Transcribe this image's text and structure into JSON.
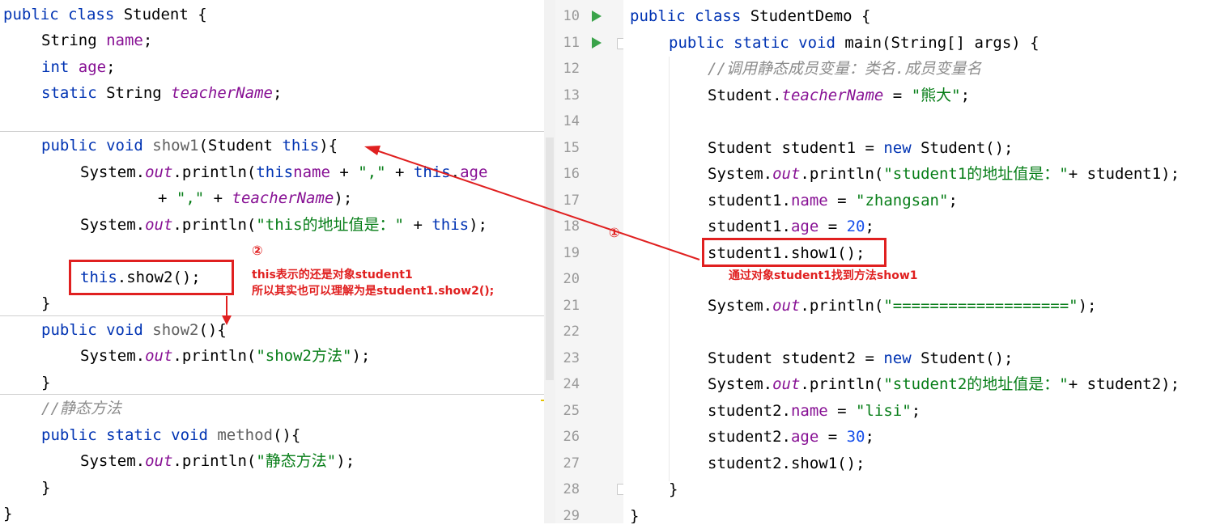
{
  "left_code": {
    "line1": {
      "a": "public class",
      "b": " Student {"
    },
    "line2": {
      "a": "String ",
      "b": "name",
      ";": ";"
    },
    "line3": {
      "a": "int ",
      "b": "age",
      ";": ";"
    },
    "line4": {
      "a": "static ",
      "b": "String ",
      "c": "teacherName",
      ";": ";"
    },
    "line5": {
      "a": "public void ",
      "b": "show1",
      "c": "(Student ",
      "d": "this",
      "e": "){"
    },
    "line6": {
      "a": "System.",
      "b": "out",
      "c": ".println(",
      "d": "this",
      ".": ".",
      "f": "name",
      "g": " + ",
      "h": "\",\"",
      "i": " + ",
      "j": "this",
      "k": ".",
      "l": "age"
    },
    "line7": {
      "a": "+ ",
      "b": "\",\"",
      "c": " + ",
      "d": "teacherName",
      "e": ");"
    },
    "line8": {
      "a": "System.",
      "b": "out",
      "c": ".println(",
      "d": "\"this的地址值是：\"",
      "e": " + ",
      "f": "this",
      "g": ");"
    },
    "line9": {
      "a": "this",
      "b": ".show2();"
    },
    "line10": {
      "a": "}"
    },
    "line11": {
      "a": "public void ",
      "b": "show2",
      "c": "(){"
    },
    "line12": {
      "a": "System.",
      "b": "out",
      "c": ".println(",
      "d": "\"show2方法\"",
      "e": ");"
    },
    "line13": {
      "a": "}"
    },
    "line14": {
      "a": "//静态方法"
    },
    "line15": {
      "a": "public static void ",
      "b": "method",
      "c": "(){"
    },
    "line16": {
      "a": "System.",
      "b": "out",
      "c": ".println(",
      "d": "\"静态方法\"",
      "e": ");"
    },
    "line17": {
      "a": "}"
    },
    "line18": {
      "a": "}"
    }
  },
  "line_numbers": [
    "10",
    "11",
    "12",
    "13",
    "14",
    "15",
    "16",
    "17",
    "18",
    "19",
    "20",
    "21",
    "22",
    "23",
    "24",
    "25",
    "26",
    "27",
    "28",
    "29"
  ],
  "right_code": {
    "r10": {
      "a": "public class",
      "b": " StudentDemo {"
    },
    "r11": {
      "a": "public static void ",
      "b": "main",
      "c": "(String[] args) {"
    },
    "r12": {
      "a": "//调用静态成员变量：类名.成员变量名"
    },
    "r13": {
      "a": "Student.",
      "b": "teacherName",
      "c": " = ",
      "d": "\"熊大\"",
      "e": ";"
    },
    "r15": {
      "a": "Student student1 = ",
      "b": "new",
      "c": " Student();"
    },
    "r16": {
      "a": "System.",
      "b": "out",
      "c": ".println(",
      "d": "\"student1的地址值是：\"",
      "e": "+ student1);"
    },
    "r17": {
      "a": "student1.",
      "b": "name",
      "c": " = ",
      "d": "\"zhangsan\"",
      "e": ";"
    },
    "r18": {
      "a": "student1.",
      "b": "age",
      "c": " = ",
      "d": "20",
      "e": ";"
    },
    "r19": {
      "a": "student1.show1();"
    },
    "r21": {
      "a": "System.",
      "b": "out",
      "c": ".println(",
      "d": "\"===================\"",
      "e": ");"
    },
    "r23": {
      "a": "Student student2 = ",
      "b": "new",
      "c": " Student();"
    },
    "r24": {
      "a": "System.",
      "b": "out",
      "c": ".println(",
      "d": "\"student2的地址值是：\"",
      "e": "+ student2);"
    },
    "r25": {
      "a": "student2.",
      "b": "name",
      "c": " = ",
      "d": "\"lisi\"",
      "e": ";"
    },
    "r26": {
      "a": "student2.",
      "b": "age",
      "c": " = ",
      "d": "30",
      "e": ";"
    },
    "r27": {
      "a": "student2.show1();"
    },
    "r28": {
      "a": "}"
    },
    "r29": {
      "a": "}"
    }
  },
  "annotations": {
    "circle1": "①",
    "circle2": "②",
    "note1": "通过对象student1找到方法show1",
    "note2_line1": "this表示的还是对象student1",
    "note2_line2": "所以其实也可以理解为是student1.show2();"
  },
  "colors": {
    "keyword": "#0033b3",
    "field": "#871094",
    "string": "#067d17",
    "number": "#1750eb",
    "comment": "#8c8c8c",
    "annotation": "#e02020",
    "run": "#3aa34a"
  }
}
